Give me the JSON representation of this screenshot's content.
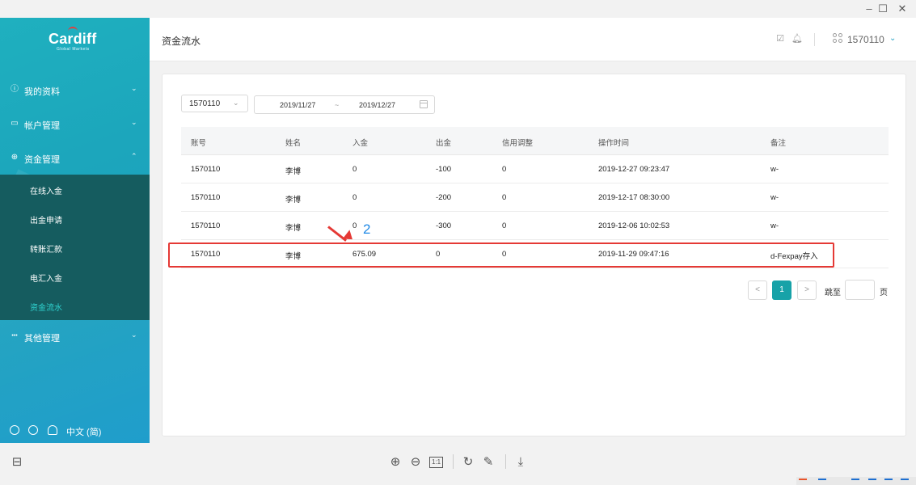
{
  "window": {
    "controls": [
      "–",
      "☐",
      "✕"
    ]
  },
  "sidebar": {
    "logo": {
      "name": "Cardiff",
      "tagline": "Global Markets"
    },
    "menu": [
      {
        "label": "我的资料",
        "icon": "info-icon",
        "glyph": "ⓘ",
        "chevron": "⌄"
      },
      {
        "label": "帐户管理",
        "icon": "card-icon",
        "glyph": "▭",
        "chevron": "⌄"
      },
      {
        "label": "资金管理",
        "icon": "money-icon",
        "glyph": "⊕",
        "chevron": "⌃"
      },
      {
        "label": "其他管理",
        "icon": "more-icon",
        "glyph": "•••",
        "chevron": "⌄"
      }
    ],
    "submenu": [
      {
        "label": "在线入金"
      },
      {
        "label": "出金申请"
      },
      {
        "label": "转账汇款"
      },
      {
        "label": "电汇入金"
      },
      {
        "label": "资金流水"
      }
    ],
    "footer": {
      "language": "中文 (简)"
    }
  },
  "header": {
    "title": "资金流水",
    "username": "1570110"
  },
  "filters": {
    "account": "1570110",
    "date_from": "2019/11/27",
    "date_sep": "~",
    "date_to": "2019/12/27"
  },
  "table": {
    "columns": [
      "账号",
      "姓名",
      "入金",
      "出金",
      "信用调整",
      "操作时间",
      "备注"
    ],
    "rows": [
      [
        "1570110",
        "李博",
        "0",
        "-100",
        "0",
        "2019-12-27 09:23:47",
        "w-"
      ],
      [
        "1570110",
        "李博",
        "0",
        "-200",
        "0",
        "2019-12-17 08:30:00",
        "w-"
      ],
      [
        "1570110",
        "李博",
        "0",
        "-300",
        "0",
        "2019-12-06 10:02:53",
        "w-"
      ],
      [
        "1570110",
        "李博",
        "675.09",
        "0",
        "0",
        "2019-11-29 09:47:16",
        "d-Fexpay存入"
      ]
    ]
  },
  "annotation": {
    "number": "2",
    "color": "#e53935",
    "number_color": "#1e88e5"
  },
  "pagination": {
    "prev": "<",
    "current": "1",
    "next": ">",
    "jump_label": "跳至",
    "page_suffix": "页"
  },
  "toolbar": {
    "zoom_in": "⊕",
    "zoom_out": "⊖",
    "actual_size": "1:1",
    "rotate": "↻",
    "edit": "✎",
    "download": "⤓"
  },
  "colors": {
    "accent": "#17a2a8",
    "sidebar": "#1ca6bc",
    "submenu_bg": "#155c5f",
    "active_sub": "#2fd3d0"
  }
}
